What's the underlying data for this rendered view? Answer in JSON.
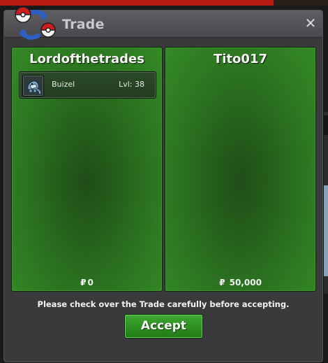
{
  "window": {
    "title": "Trade",
    "close_label": "✕"
  },
  "left_panel": {
    "player_name": "Lordofthetrades",
    "items": [
      {
        "name": "Buizel",
        "level": "Lvl: 38",
        "icon": "buizel-icon"
      }
    ],
    "currency_symbol": "₽",
    "money": "0"
  },
  "right_panel": {
    "player_name": "Tito017",
    "items": [],
    "currency_symbol": "₽",
    "money": "50,000"
  },
  "footer": {
    "notice": "Please check over the Trade carefully before accepting.",
    "accept_label": "Accept"
  },
  "colors": {
    "panel_green": "#2e7a22",
    "accept_green": "#2f9525",
    "window_bg": "#3a3a3c"
  }
}
